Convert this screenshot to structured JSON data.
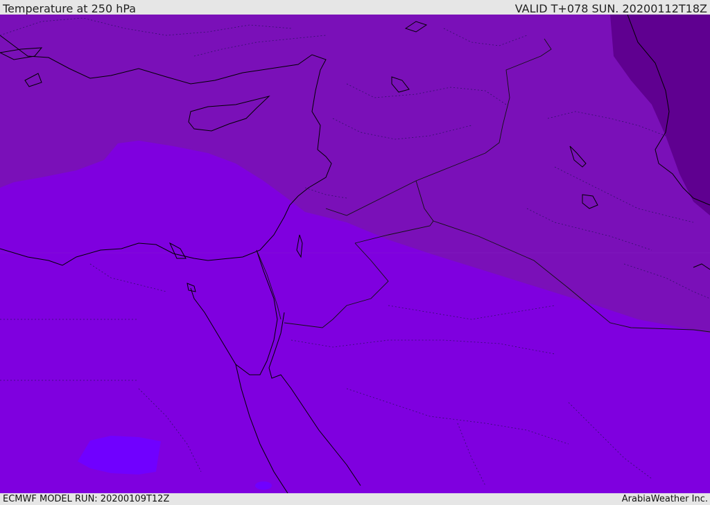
{
  "header": {
    "title": "Temperature at 250 hPa",
    "valid": "VALID T+078 SUN. 20200112T18Z"
  },
  "footer": {
    "model_run": "ECMWF MODEL RUN: 20200109T12Z",
    "brand": "ArabiaWeather Inc."
  },
  "colors": {
    "band_warmest": "#7f00df",
    "band_mid": "#7a10b8",
    "band_cold": "#5f0090",
    "band_cool_spot": "#7000ff",
    "coastline": "#000000"
  },
  "icons": {
    "map": "map-canvas"
  }
}
